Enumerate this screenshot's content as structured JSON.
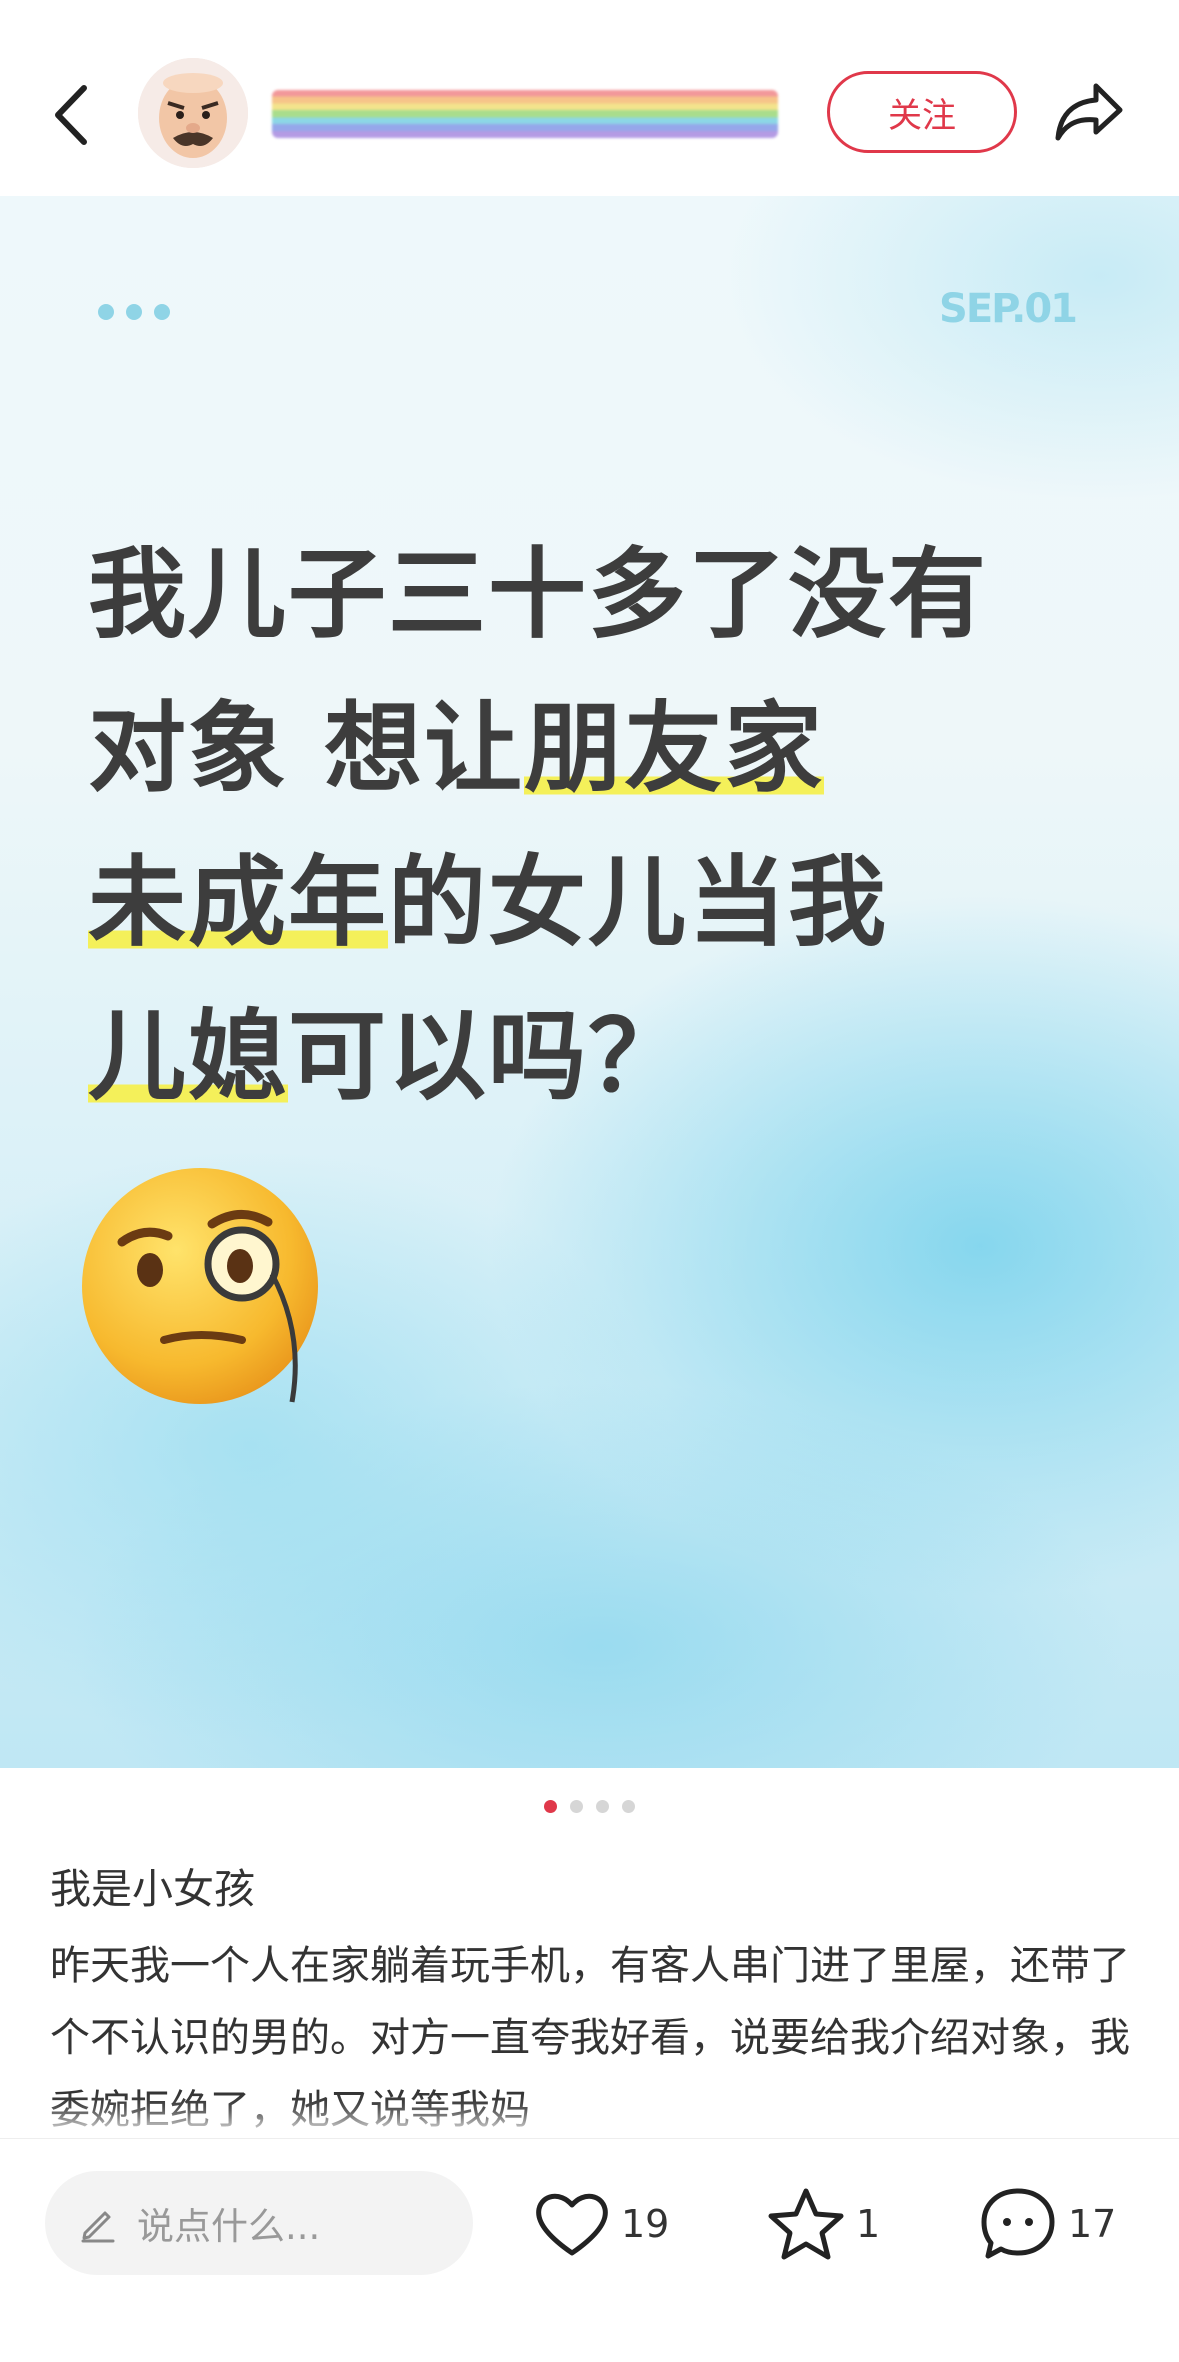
{
  "header": {
    "follow_label": "关注"
  },
  "card": {
    "date_label": "SEP.01",
    "headline": {
      "line1": "我儿子三十多了没有",
      "line2_a": "对象 想让",
      "line2_b": "朋友家",
      "line3_a": "未成年",
      "line3_b": "的女儿当我",
      "line4_a": "儿媳",
      "line4_b": "可以吗？"
    },
    "emoji": "face-with-monocle-icon"
  },
  "pager": {
    "total": 4,
    "current": 1
  },
  "post": {
    "title": "我是小女孩",
    "body": "昨天我一个人在家躺着玩手机，有客人串门进了里屋，还带了个不认识的男的。对方一直夸我好看，说要给我介绍对象，我委婉拒绝了，她又说等我妈"
  },
  "bottom_bar": {
    "comment_placeholder": "说点什么...",
    "likes": "19",
    "favorites": "1",
    "comments": "17"
  },
  "colors": {
    "accent": "#e0384a",
    "text": "#333333",
    "highlight": "#f4f05a",
    "sky": "#8fd4e6"
  }
}
